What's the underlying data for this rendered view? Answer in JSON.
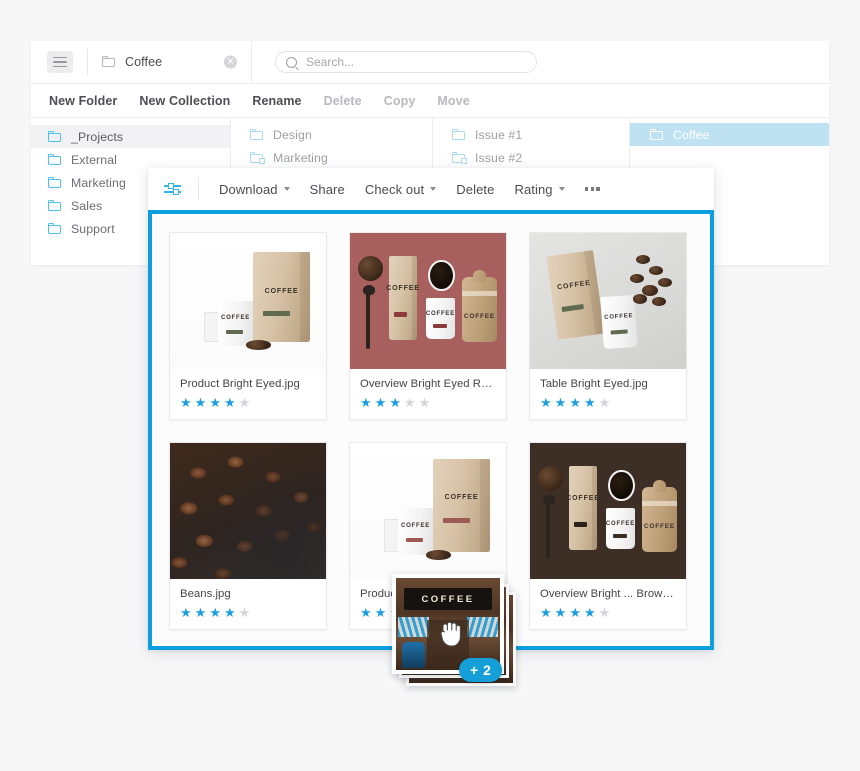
{
  "window": {
    "topbar": {
      "menu_icon": "hamburger-icon",
      "breadcrumb": {
        "folder_icon": "folder-icon",
        "label": "Coffee",
        "clear_icon": "clear-circle-icon",
        "clear_glyph": "✕"
      },
      "search": {
        "icon": "search-icon",
        "placeholder": "Search...",
        "value": ""
      }
    },
    "menubar": {
      "items": [
        {
          "label": "New Folder",
          "enabled": true
        },
        {
          "label": "New Collection",
          "enabled": true
        },
        {
          "label": "Rename",
          "enabled": true
        },
        {
          "label": "Delete",
          "enabled": false
        },
        {
          "label": "Copy",
          "enabled": false
        },
        {
          "label": "Move",
          "enabled": false
        }
      ]
    },
    "columns": [
      {
        "name": "column-1",
        "rows": [
          {
            "label": "_Projects",
            "selected": true,
            "locked": false
          },
          {
            "label": "External",
            "selected": false,
            "locked": false
          },
          {
            "label": "Marketing",
            "selected": false,
            "locked": false
          },
          {
            "label": "Sales",
            "selected": false,
            "locked": false
          },
          {
            "label": "Support",
            "selected": false,
            "locked": false
          }
        ]
      },
      {
        "name": "column-2",
        "rows": [
          {
            "label": "Design",
            "selected": false,
            "locked": false
          },
          {
            "label": "Marketing",
            "selected": false,
            "locked": true
          }
        ]
      },
      {
        "name": "column-3",
        "rows": [
          {
            "label": "Issue #1",
            "selected": false,
            "locked": false
          },
          {
            "label": "Issue #2",
            "selected": false,
            "locked": true
          }
        ]
      },
      {
        "name": "column-4",
        "rows": [
          {
            "label": "Coffee",
            "selected": true,
            "locked": false
          }
        ]
      }
    ]
  },
  "asset_panel": {
    "toolbar": {
      "filter_icon": "filter-sliders-icon",
      "items": [
        {
          "label": "Download",
          "caret": true
        },
        {
          "label": "Share",
          "caret": false
        },
        {
          "label": "Check out",
          "caret": true
        },
        {
          "label": "Delete",
          "caret": false
        },
        {
          "label": "Rating",
          "caret": true
        }
      ],
      "more_icon": "more-horizontal-icon"
    },
    "selection_border_color": "#0d9ee0",
    "accent_color": "#1c9fe0",
    "cards": [
      {
        "title": "Product Bright Eyed.jpg",
        "rating": 4,
        "max_rating": 5,
        "art": "product-white"
      },
      {
        "title": "Overview Bright Eyed Red.jpg",
        "rating": 3,
        "max_rating": 5,
        "art": "flatlay-red"
      },
      {
        "title": "Table Bright Eyed.jpg",
        "rating": 4,
        "max_rating": 5,
        "art": "table-grey"
      },
      {
        "title": "Beans.jpg",
        "rating": 4,
        "max_rating": 5,
        "art": "beans-photo"
      },
      {
        "title": "Product Bright Eyed Red.jpg",
        "rating": 2,
        "max_rating": 5,
        "art": "product-white-red"
      },
      {
        "title": "Overview Bright ... Brown.jpg",
        "rating": 4,
        "max_rating": 5,
        "art": "flatlay-brown"
      }
    ],
    "star_glyph": "★"
  },
  "drag": {
    "badge_label": "+ 2",
    "badge_color": "#159fd8",
    "cursor_icon": "grabbing-hand-cursor",
    "thumbnail_text": "COFFEE"
  }
}
